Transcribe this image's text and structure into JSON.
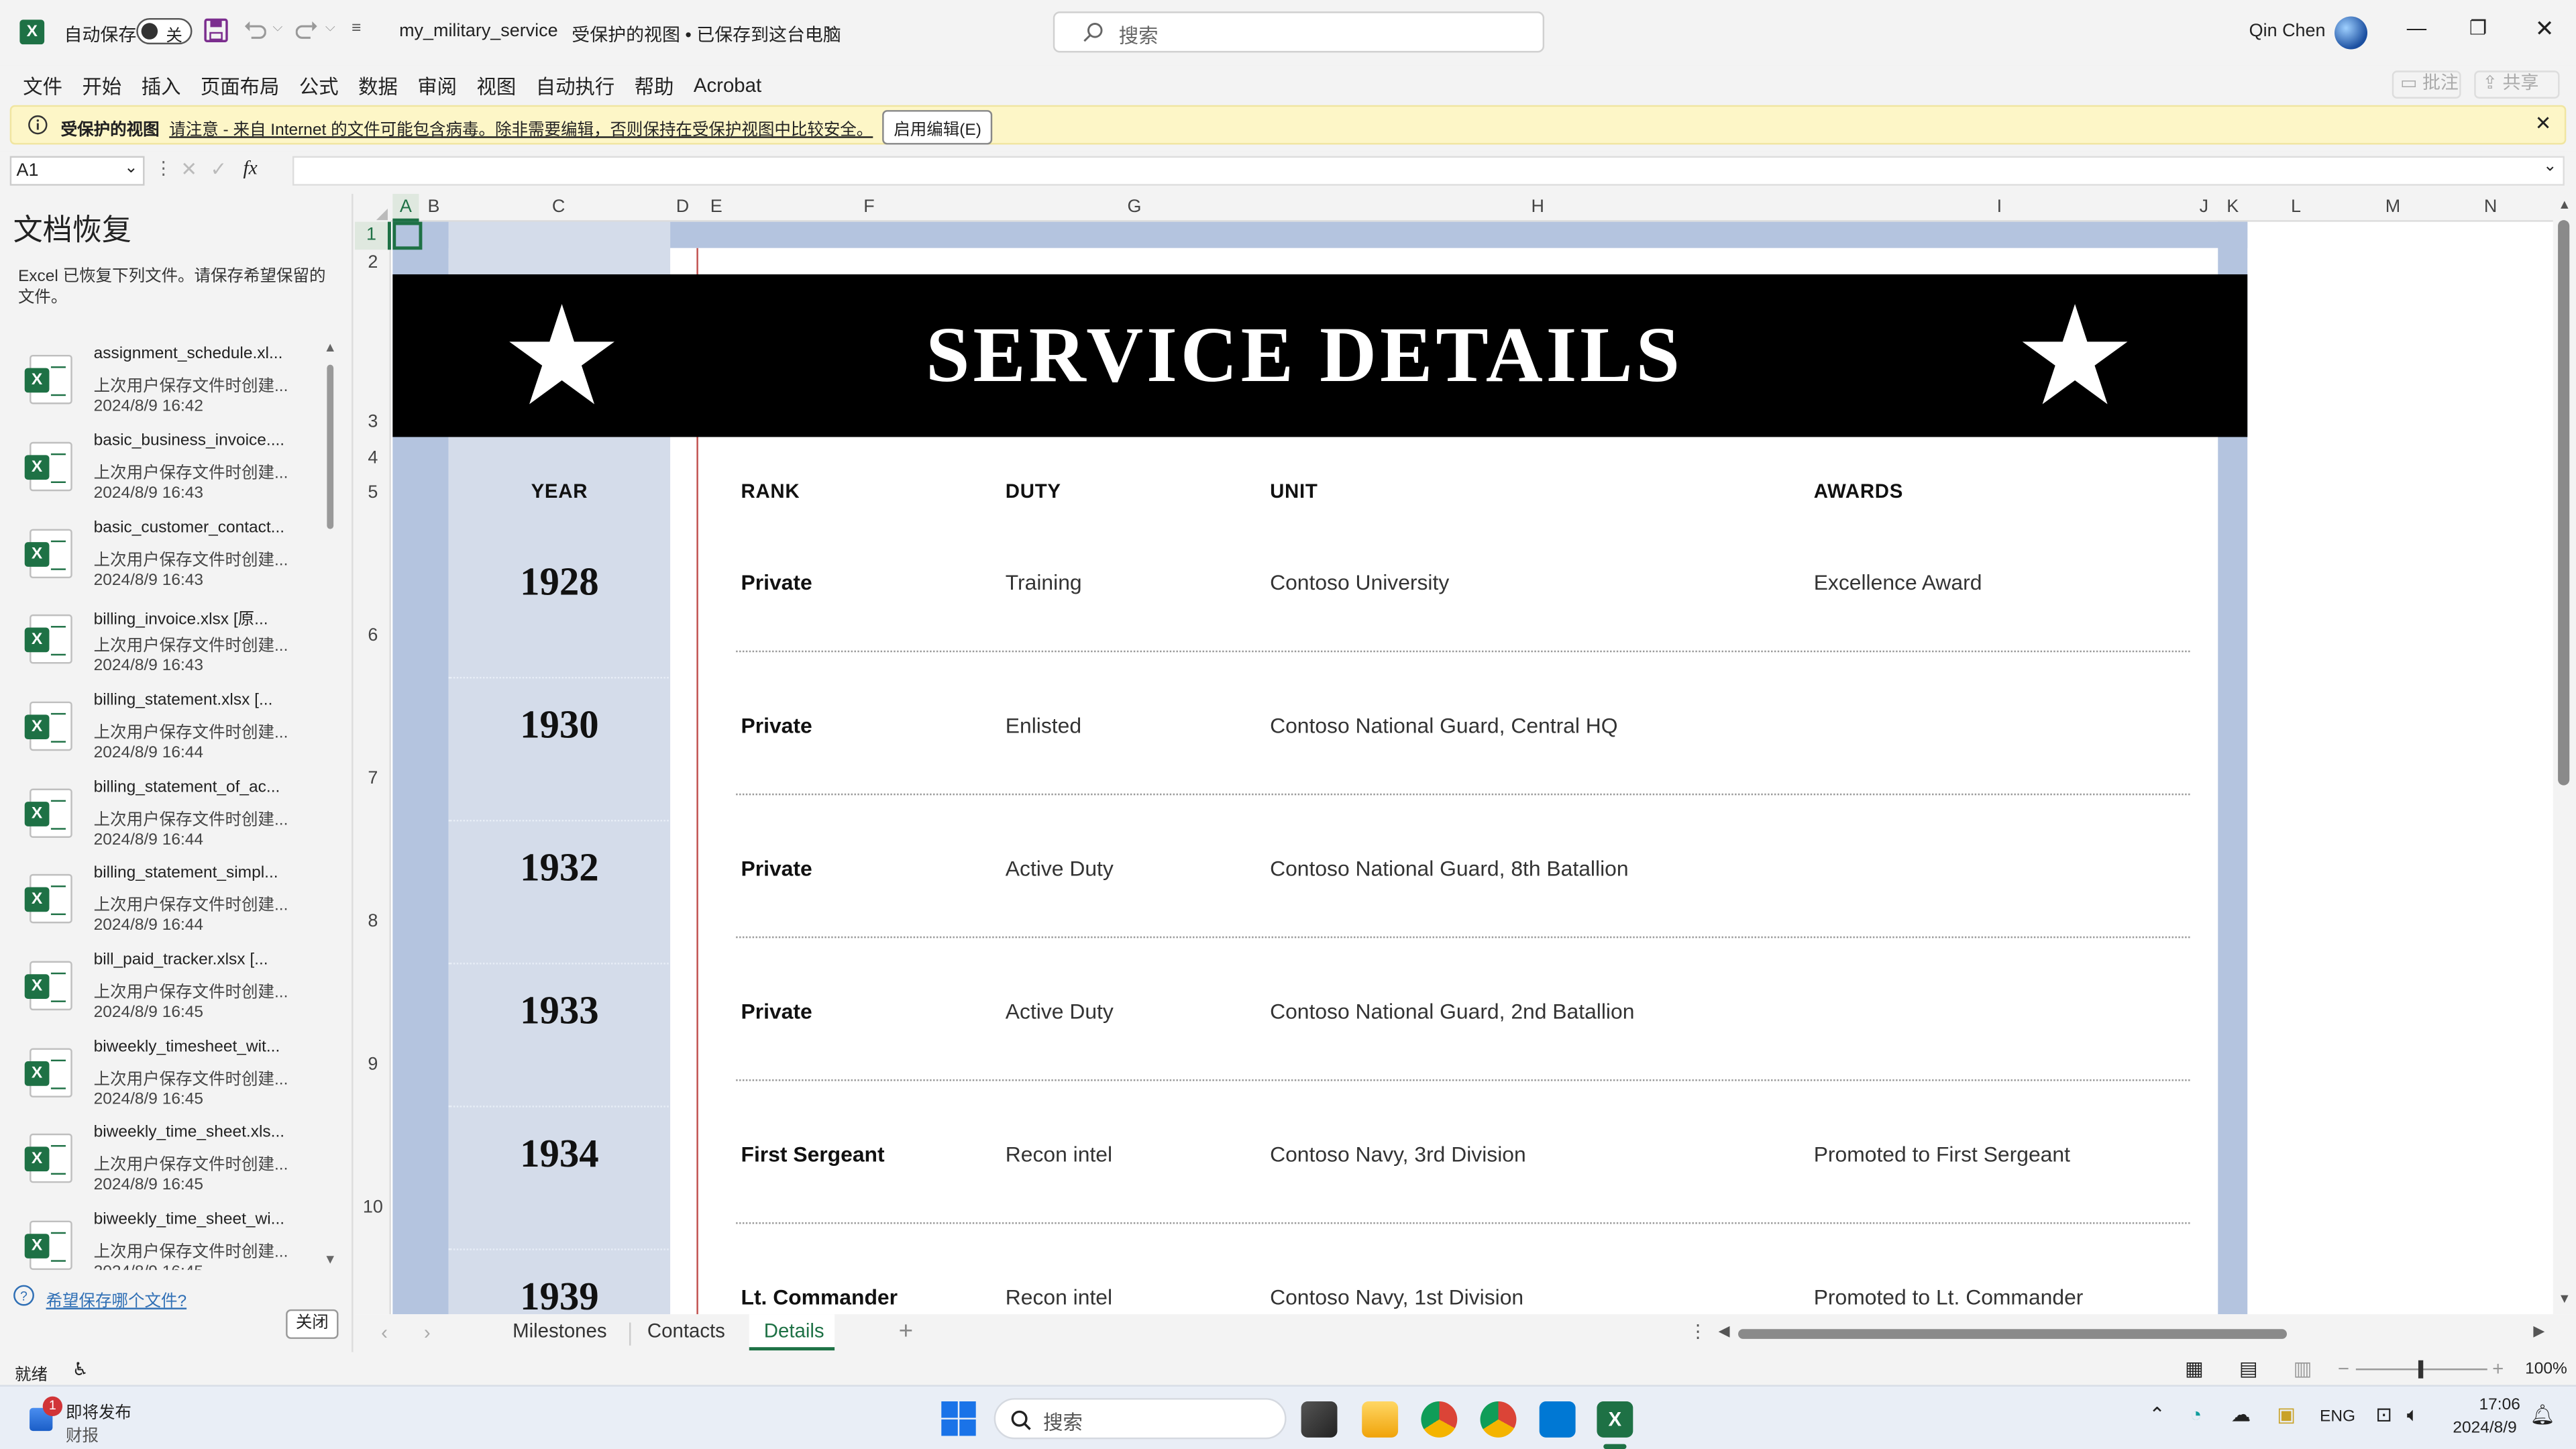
{
  "titlebar": {
    "autosave_label": "自动保存",
    "autosave_state": "关",
    "filename": "my_military_service",
    "doc_status": "受保护的视图 • 已保存到这台电脑",
    "search_placeholder": "搜索",
    "user_name": "Qin Chen"
  },
  "menu": {
    "items": [
      "文件",
      "开始",
      "插入",
      "页面布局",
      "公式",
      "数据",
      "审阅",
      "视图",
      "自动执行",
      "帮助",
      "Acrobat"
    ],
    "comment_label": "批注",
    "share_label": "共享"
  },
  "banner": {
    "title": "受保护的视图",
    "message": "请注意 - 来自 Internet 的文件可能包含病毒。除非需要编辑，否则保持在受保护视图中比较安全。",
    "enable_button": "启用编辑(E)"
  },
  "formula_bar": {
    "cell_ref": "A1",
    "fx_label": "fx",
    "formula": ""
  },
  "recovery": {
    "title": "文档恢复",
    "intro": "Excel 已恢复下列文件。请保存希望保留的文件。",
    "files": [
      {
        "name": "assignment_schedule.xl...",
        "desc": "上次用户保存文件时创建...",
        "time": "2024/8/9 16:42"
      },
      {
        "name": "basic_business_invoice....",
        "desc": "上次用户保存文件时创建...",
        "time": "2024/8/9 16:43"
      },
      {
        "name": "basic_customer_contact...",
        "desc": "上次用户保存文件时创建...",
        "time": "2024/8/9 16:43"
      },
      {
        "name": "billing_invoice.xlsx  [原...",
        "desc": "上次用户保存文件时创建...",
        "time": "2024/8/9 16:43"
      },
      {
        "name": "billing_statement.xlsx  [...",
        "desc": "上次用户保存文件时创建...",
        "time": "2024/8/9 16:44"
      },
      {
        "name": "billing_statement_of_ac...",
        "desc": "上次用户保存文件时创建...",
        "time": "2024/8/9 16:44"
      },
      {
        "name": "billing_statement_simpl...",
        "desc": "上次用户保存文件时创建...",
        "time": "2024/8/9 16:44"
      },
      {
        "name": "bill_paid_tracker.xlsx  [...",
        "desc": "上次用户保存文件时创建...",
        "time": "2024/8/9 16:45"
      },
      {
        "name": "biweekly_timesheet_wit...",
        "desc": "上次用户保存文件时创建...",
        "time": "2024/8/9 16:45"
      },
      {
        "name": "biweekly_time_sheet.xls...",
        "desc": "上次用户保存文件时创建...",
        "time": "2024/8/9 16:45"
      },
      {
        "name": "biweekly_time_sheet_wi...",
        "desc": "上次用户保存文件时创建...",
        "time": "2024/8/9 16:45"
      }
    ],
    "help_link": "希望保存哪个文件?",
    "close_button": "关闭"
  },
  "grid": {
    "columns": [
      "A",
      "B",
      "C",
      "D",
      "E",
      "F",
      "G",
      "H",
      "I",
      "J",
      "K",
      "L",
      "M",
      "N"
    ],
    "rows": [
      "1",
      "2",
      "3",
      "4",
      "5",
      "6",
      "7",
      "8",
      "9",
      "10"
    ],
    "banner_title": "SERVICE DETAILS",
    "headers": {
      "year": "YEAR",
      "rank": "RANK",
      "duty": "DUTY",
      "unit": "UNIT",
      "awards": "AWARDS"
    },
    "records": [
      {
        "year": "1928",
        "rank": "Private",
        "duty": "Training",
        "unit": "Contoso University",
        "awards": "Excellence Award"
      },
      {
        "year": "1930",
        "rank": "Private",
        "duty": "Enlisted",
        "unit": "Contoso National Guard, Central HQ",
        "awards": ""
      },
      {
        "year": "1932",
        "rank": "Private",
        "duty": "Active Duty",
        "unit": "Contoso National Guard, 8th Batallion",
        "awards": ""
      },
      {
        "year": "1933",
        "rank": "Private",
        "duty": "Active Duty",
        "unit": "Contoso National Guard, 2nd Batallion",
        "awards": ""
      },
      {
        "year": "1934",
        "rank": "First Sergeant",
        "duty": "Recon intel",
        "unit": "Contoso Navy, 3rd Division",
        "awards": "Promoted to First Sergeant"
      },
      {
        "year": "1939",
        "rank": "Lt. Commander",
        "duty": "Recon intel",
        "unit": "Contoso Navy, 1st Division",
        "awards": "Promoted to Lt. Commander"
      }
    ]
  },
  "sheet_tabs": {
    "tabs": [
      "Milestones",
      "Contacts",
      "Details"
    ],
    "active": "Details"
  },
  "statusbar": {
    "ready": "就绪",
    "zoom": "100%"
  },
  "taskbar": {
    "news_badge": "1",
    "news_title": "即将发布",
    "news_sub": "财报",
    "search_placeholder": "搜索",
    "lang": "ENG",
    "time": "17:06",
    "date": "2024/8/9"
  },
  "colors": {
    "navy_band": "#b4c4df",
    "year_column": "#d4dcea",
    "banner_black": "#000000",
    "accent_red": "#c0504d",
    "excel_green": "#1e7145",
    "protected_yellow": "#fdf6c7"
  }
}
